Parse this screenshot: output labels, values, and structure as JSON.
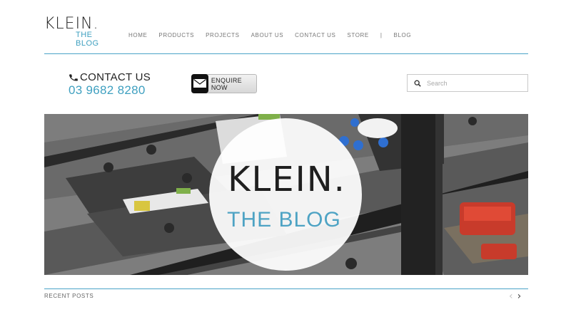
{
  "logo": {
    "line1": "KLEIN.",
    "line2": "THE BLOG"
  },
  "nav": {
    "items": [
      {
        "label": "HOME"
      },
      {
        "label": "PRODUCTS"
      },
      {
        "label": "PROJECTS"
      },
      {
        "label": "ABOUT US"
      },
      {
        "label": "CONTACT US"
      },
      {
        "label": "STORE"
      },
      {
        "label": "|"
      },
      {
        "label": "BLOG"
      }
    ]
  },
  "contact": {
    "label": "CONTACT US",
    "phone": "03 9682 8280",
    "icon": "phone-icon"
  },
  "enquire": {
    "label": "ENQUIRE NOW",
    "icon": "envelope-icon"
  },
  "search": {
    "placeholder": "Search",
    "value": "",
    "icon": "search-icon"
  },
  "hero": {
    "title": "KLEIN.",
    "subtitle": "THE BLOG"
  },
  "recent": {
    "label": "RECENT POSTS",
    "prev": "‹",
    "next": "›"
  },
  "colors": {
    "accent": "#3fa0c0",
    "rule": "#4aa3c7",
    "text_dark": "#222222"
  }
}
